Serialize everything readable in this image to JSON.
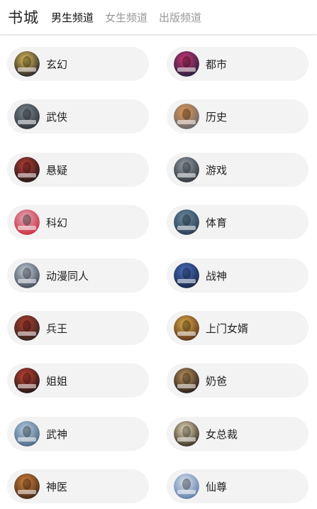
{
  "header": {
    "title": "书城",
    "tabs": [
      {
        "label": "男生频道",
        "active": true
      },
      {
        "label": "女生频道",
        "active": false
      },
      {
        "label": "出版频道",
        "active": false
      }
    ]
  },
  "categories": [
    {
      "label": "玄幻",
      "icon": "book-cover-xuanhuan-icon",
      "colors": [
        "#e6c65a",
        "#1d1a26"
      ]
    },
    {
      "label": "都市",
      "icon": "book-cover-dushi-icon",
      "colors": [
        "#d8377a",
        "#1b1f3a"
      ]
    },
    {
      "label": "武侠",
      "icon": "book-cover-wuxia-icon",
      "colors": [
        "#7e8a92",
        "#2b2f36"
      ]
    },
    {
      "label": "历史",
      "icon": "book-cover-lishi-icon",
      "colors": [
        "#e89a52",
        "#5d6470"
      ]
    },
    {
      "label": "悬疑",
      "icon": "book-cover-xuanyi-icon",
      "colors": [
        "#c4413a",
        "#151515"
      ]
    },
    {
      "label": "游戏",
      "icon": "book-cover-youxi-icon",
      "colors": [
        "#9aa6b0",
        "#2a2e33"
      ]
    },
    {
      "label": "科幻",
      "icon": "book-cover-kehuan-icon",
      "colors": [
        "#e5aeb9",
        "#c7283e"
      ]
    },
    {
      "label": "体育",
      "icon": "book-cover-tiyu-icon",
      "colors": [
        "#6d8fa8",
        "#27394c"
      ]
    },
    {
      "label": "动漫同人",
      "icon": "book-cover-dongman-icon",
      "colors": [
        "#c9d3e0",
        "#3a4250"
      ]
    },
    {
      "label": "战神",
      "icon": "book-cover-zhanshen-icon",
      "colors": [
        "#4d74c8",
        "#14223e"
      ]
    },
    {
      "label": "兵王",
      "icon": "book-cover-bingwang-icon",
      "colors": [
        "#b7402f",
        "#2a2220"
      ]
    },
    {
      "label": "上门女婿",
      "icon": "book-cover-shangmen-icon",
      "colors": [
        "#e0b04a",
        "#532e1a"
      ]
    },
    {
      "label": "姐姐",
      "icon": "book-cover-jiejie-icon",
      "colors": [
        "#d04836",
        "#161214"
      ]
    },
    {
      "label": "奶爸",
      "icon": "book-cover-naiba-icon",
      "colors": [
        "#c89a62",
        "#1b1715"
      ]
    },
    {
      "label": "武神",
      "icon": "book-cover-wushen-icon",
      "colors": [
        "#b8d2e8",
        "#47617c"
      ]
    },
    {
      "label": "女总裁",
      "icon": "book-cover-nvzongcai-icon",
      "colors": [
        "#f2e6c4",
        "#2c2416"
      ]
    },
    {
      "label": "神医",
      "icon": "book-cover-shenyi-icon",
      "colors": [
        "#d9863c",
        "#3c2315"
      ]
    },
    {
      "label": "仙尊",
      "icon": "book-cover-xianzun-icon",
      "colors": [
        "#dfe8f4",
        "#5b79a4"
      ]
    }
  ],
  "colors": {
    "pill_background": "#f3f3f3",
    "active_tab": "#111111",
    "inactive_tab": "#999999"
  }
}
